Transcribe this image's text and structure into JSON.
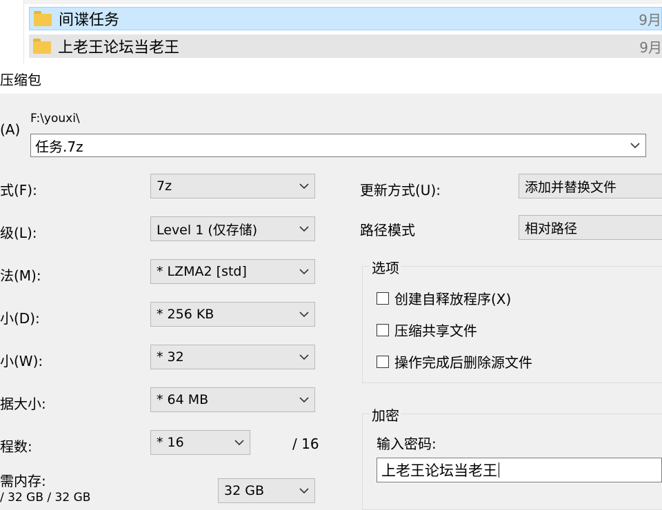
{
  "explorer": {
    "rows": [
      {
        "name": "间谍任务",
        "date": "9月"
      },
      {
        "name": "上老王论坛当老王",
        "date": "9月"
      }
    ]
  },
  "dialog": {
    "title": "压缩包",
    "archive": {
      "label": "(A)",
      "path": "F:\\youxi\\",
      "value": "任务.7z"
    },
    "left": {
      "format": {
        "label": "式(F):",
        "value": "7z"
      },
      "level": {
        "label": "级(L):",
        "value": "Level 1 (仅存储)"
      },
      "method": {
        "label": "法(M):",
        "value": "*  LZMA2 [std]"
      },
      "dict": {
        "label": "小(D):",
        "value": "*  256 KB"
      },
      "word": {
        "label": "小(W):",
        "value": "*  32"
      },
      "solid": {
        "label": "据大小:",
        "value": "*  64 MB"
      },
      "threads": {
        "label": "程数:",
        "value": "*  16",
        "max": "/ 16"
      },
      "memory": {
        "label": "需内存:",
        "sub": "/ 32 GB / 32 GB",
        "value": "32 GB"
      }
    },
    "right": {
      "update": {
        "label": "更新方式(U):",
        "value": "添加并替换文件"
      },
      "path_mode": {
        "label": "路径模式",
        "value": "相对路径"
      },
      "options": {
        "title": "选项",
        "items": [
          "创建自释放程序(X)",
          "压缩共享文件",
          "操作完成后删除源文件"
        ]
      },
      "encryption": {
        "title": "加密",
        "password_label": "输入密码:",
        "password_value": "上老王论坛当老王"
      }
    }
  }
}
